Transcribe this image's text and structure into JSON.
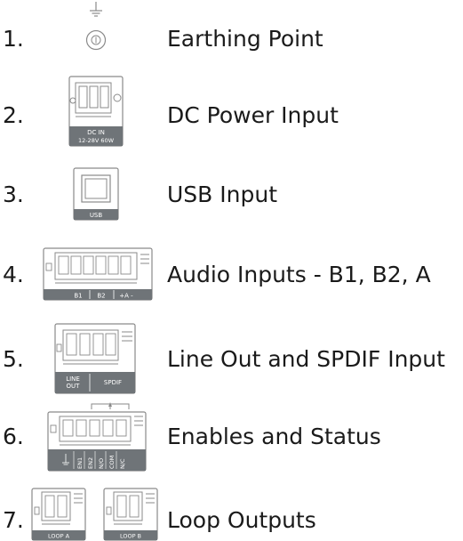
{
  "items": [
    {
      "number": "1.",
      "label": "Earthing Point"
    },
    {
      "number": "2.",
      "label": "DC Power Input",
      "icon_text": [
        "DC IN",
        "12-28V  60W"
      ]
    },
    {
      "number": "3.",
      "label": "USB Input",
      "icon_text": [
        "USB"
      ]
    },
    {
      "number": "4.",
      "label": "Audio Inputs - B1, B2, A",
      "icon_text": [
        "B1",
        "B2",
        "+A -"
      ]
    },
    {
      "number": "5.",
      "label": "Line Out and SPDIF Input",
      "icon_text": [
        "LINE",
        "OUT",
        "SPDIF"
      ]
    },
    {
      "number": "6.",
      "label": "Enables and Status",
      "icon_text": [
        "EN1",
        "EN2",
        "N/O",
        "COM",
        "N/C"
      ]
    },
    {
      "number": "7.",
      "label": "Loop Outputs",
      "icon_text": [
        "LOOP A",
        "LOOP B"
      ]
    }
  ],
  "colors": {
    "icon_stroke": "#8a8a8a",
    "icon_band": "#6f7478",
    "text": "#1a1a1a"
  }
}
